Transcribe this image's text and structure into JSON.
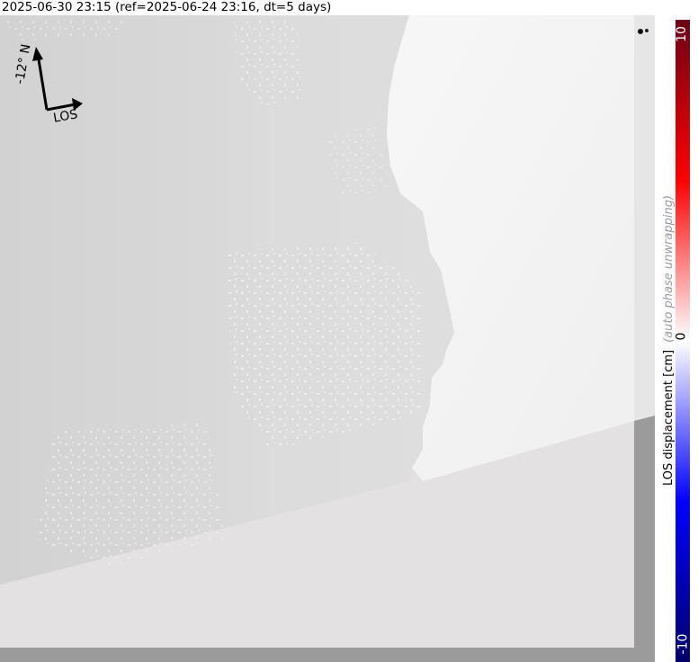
{
  "header": {
    "title": "2025-06-30 23:15 (ref=2025-06-24 23:16, dt=5 days)"
  },
  "compass": {
    "north_label": "-12° N",
    "los_label": "LOS",
    "north_color": "#000000"
  },
  "colorbar": {
    "max_label": "10",
    "mid_label": "0",
    "min_label": "-10",
    "axis_label": "LOS displacement [cm]",
    "note": "(auto phase unwrapping)",
    "color_max": "#6b0015",
    "color_mid": "#ffffff",
    "color_min": "#00006b"
  },
  "map": {
    "background_fill": "#e3e1e2",
    "margin_fill": "#9b9b9b",
    "left_region_fill": "#d6d6d6",
    "right_region_fill": "#f4f4f4"
  }
}
